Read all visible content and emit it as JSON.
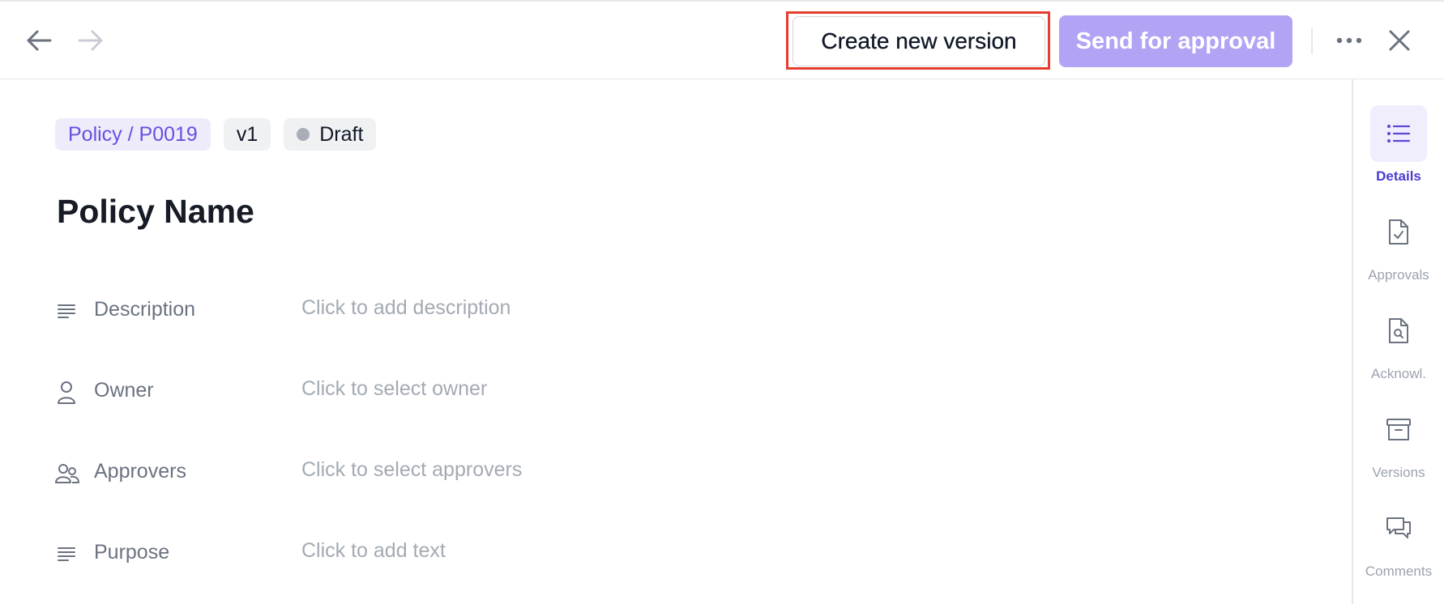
{
  "toolbar": {
    "create_new_version_label": "Create new version",
    "send_for_approval_label": "Send for approval"
  },
  "record": {
    "breadcrumb": "Policy / P0019",
    "version": "v1",
    "status": "Draft",
    "title": "Policy Name"
  },
  "fields": [
    {
      "label": "Description",
      "placeholder": "Click to add description",
      "icon": "text-lines-icon"
    },
    {
      "label": "Owner",
      "placeholder": "Click to select owner",
      "icon": "user-icon"
    },
    {
      "label": "Approvers",
      "placeholder": "Click to select approvers",
      "icon": "users-icon"
    },
    {
      "label": "Purpose",
      "placeholder": "Click to add text",
      "icon": "text-lines-icon"
    }
  ],
  "sidebar": {
    "items": [
      {
        "label": "Details",
        "icon": "list-icon",
        "active": true
      },
      {
        "label": "Approvals",
        "icon": "file-check-icon",
        "active": false
      },
      {
        "label": "Acknowl.",
        "icon": "file-search-icon",
        "active": false
      },
      {
        "label": "Versions",
        "icon": "archive-icon",
        "active": false
      },
      {
        "label": "Comments",
        "icon": "chat-bubbles-icon",
        "active": false
      }
    ]
  },
  "colors": {
    "accent": "#6a4fe0",
    "send_button_bg": "#b3a3f5",
    "highlight_border": "#e53e2e"
  }
}
